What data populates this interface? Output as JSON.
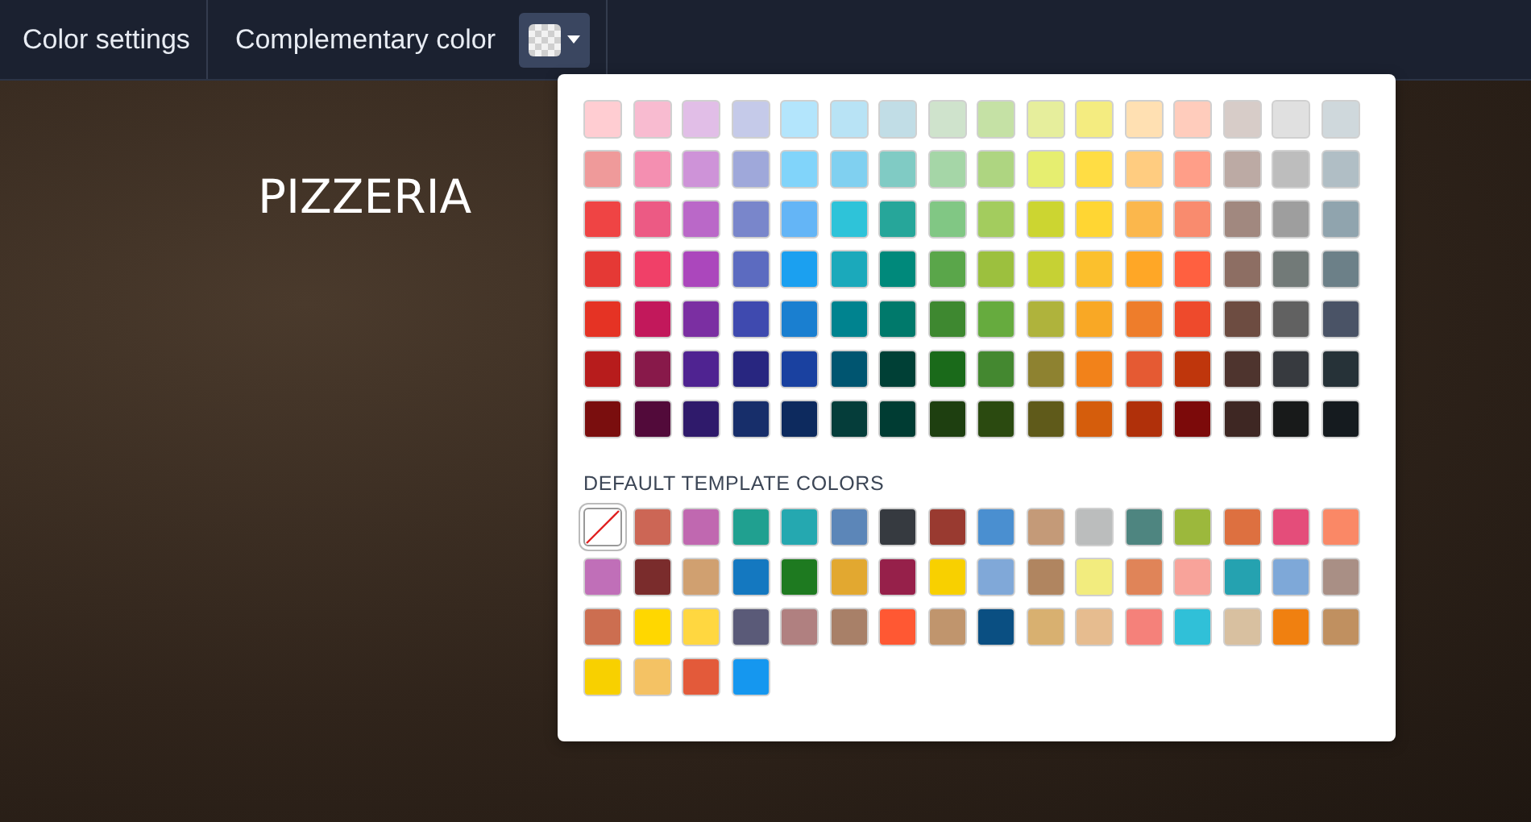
{
  "toolbar": {
    "items": [
      {
        "label": "Color settings"
      },
      {
        "label": "Complementary color"
      }
    ]
  },
  "background": {
    "heading": "PIZZERIA"
  },
  "palette": {
    "rows": [
      {
        "swatches": [
          {
            "color": "#ffcdd2"
          },
          {
            "color": "#f8bbd0"
          },
          {
            "color": "#e1bee7"
          },
          {
            "color": "#c5cae9"
          },
          {
            "color": "#b3e5fc"
          },
          {
            "color": "#b8e3f5"
          },
          {
            "color": "#c1dde6"
          },
          {
            "color": "#cfe3cc"
          },
          {
            "color": "#c5e1a5"
          },
          {
            "color": "#e6ee9c"
          },
          {
            "color": "#f4ec80"
          },
          {
            "color": "#ffe0b2"
          },
          {
            "color": "#ffccbc"
          },
          {
            "color": "#d7ccc8"
          },
          {
            "color": "#e0e0e0"
          },
          {
            "color": "#cfd8dc"
          }
        ]
      },
      {
        "swatches": [
          {
            "color": "#ef9a9a"
          },
          {
            "color": "#f48fb1"
          },
          {
            "color": "#ce93d8"
          },
          {
            "color": "#9fa8da"
          },
          {
            "color": "#81d4fa"
          },
          {
            "color": "#80d0f0"
          },
          {
            "color": "#80cbc4"
          },
          {
            "color": "#a5d6a7"
          },
          {
            "color": "#aed581"
          },
          {
            "color": "#e6ee70"
          },
          {
            "color": "#ffdd44"
          },
          {
            "color": "#ffcc80"
          },
          {
            "color": "#ff9e88"
          },
          {
            "color": "#bcaaa4"
          },
          {
            "color": "#bdbdbd"
          },
          {
            "color": "#b0bec5"
          }
        ]
      },
      {
        "swatches": [
          {
            "color": "#ef4444"
          },
          {
            "color": "#ec5a84"
          },
          {
            "color": "#ba68c8"
          },
          {
            "color": "#7986cb"
          },
          {
            "color": "#64b5f6"
          },
          {
            "color": "#2ec3d9"
          },
          {
            "color": "#26a69a"
          },
          {
            "color": "#81c784"
          },
          {
            "color": "#a3cc5e"
          },
          {
            "color": "#ccd531"
          },
          {
            "color": "#ffd633"
          },
          {
            "color": "#fbb74c"
          },
          {
            "color": "#f98b6e"
          },
          {
            "color": "#a1887f"
          },
          {
            "color": "#9e9e9e"
          },
          {
            "color": "#90a4ae"
          }
        ]
      },
      {
        "swatches": [
          {
            "color": "#e53935"
          },
          {
            "color": "#f04068"
          },
          {
            "color": "#ab47bc"
          },
          {
            "color": "#5c6bc0"
          },
          {
            "color": "#1ba0f0"
          },
          {
            "color": "#1ba9bb"
          },
          {
            "color": "#00897b"
          },
          {
            "color": "#5aa64a"
          },
          {
            "color": "#9cc03e"
          },
          {
            "color": "#c6d134"
          },
          {
            "color": "#fbc02d"
          },
          {
            "color": "#ffa726"
          },
          {
            "color": "#ff6040"
          },
          {
            "color": "#8d6e63"
          },
          {
            "color": "#727a78"
          },
          {
            "color": "#6c8088"
          }
        ]
      },
      {
        "swatches": [
          {
            "color": "#e53324"
          },
          {
            "color": "#c2185b"
          },
          {
            "color": "#7b2fa2"
          },
          {
            "color": "#3f4aaf"
          },
          {
            "color": "#1a7fd0"
          },
          {
            "color": "#00838f"
          },
          {
            "color": "#00796b"
          },
          {
            "color": "#3e8830"
          },
          {
            "color": "#66ab3e"
          },
          {
            "color": "#afb33c"
          },
          {
            "color": "#f9a825"
          },
          {
            "color": "#ee7d2b"
          },
          {
            "color": "#ee4a2c"
          },
          {
            "color": "#6d4c41"
          },
          {
            "color": "#616161"
          },
          {
            "color": "#4a5366"
          }
        ]
      },
      {
        "swatches": [
          {
            "color": "#b71c1c"
          },
          {
            "color": "#88194a"
          },
          {
            "color": "#4f2391"
          },
          {
            "color": "#282680"
          },
          {
            "color": "#1a41a0"
          },
          {
            "color": "#005570"
          },
          {
            "color": "#004036"
          },
          {
            "color": "#1a6a1a"
          },
          {
            "color": "#448830"
          },
          {
            "color": "#8e8230"
          },
          {
            "color": "#f2821a"
          },
          {
            "color": "#e55a33"
          },
          {
            "color": "#bf360c"
          },
          {
            "color": "#4e342e"
          },
          {
            "color": "#373a3f"
          },
          {
            "color": "#263238"
          }
        ]
      },
      {
        "swatches": [
          {
            "color": "#7a0e0e"
          },
          {
            "color": "#520a3a"
          },
          {
            "color": "#2f1a6b"
          },
          {
            "color": "#172e6a"
          },
          {
            "color": "#0d2a5e"
          },
          {
            "color": "#053d3a"
          },
          {
            "color": "#003c33"
          },
          {
            "color": "#1e3f10"
          },
          {
            "color": "#2b4a10"
          },
          {
            "color": "#5f5a1a"
          },
          {
            "color": "#d55d0c"
          },
          {
            "color": "#b0300a"
          },
          {
            "color": "#7c0a0a"
          },
          {
            "color": "#3e2723"
          },
          {
            "color": "#181a1a"
          },
          {
            "color": "#151b1f"
          }
        ]
      }
    ]
  },
  "default_colors": {
    "title": "DEFAULT TEMPLATE COLORS",
    "swatches": [
      {
        "kind": "none",
        "selected": true
      },
      {
        "kind": "color",
        "color": "#cc6655",
        "selected": false
      },
      {
        "kind": "color",
        "color": "#c068b0",
        "selected": false
      },
      {
        "kind": "color",
        "color": "#20a090",
        "selected": false
      },
      {
        "kind": "color",
        "color": "#25a8b0",
        "selected": false
      },
      {
        "kind": "color",
        "color": "#5c86b8",
        "selected": false
      },
      {
        "kind": "color",
        "color": "#363a40",
        "selected": false
      },
      {
        "kind": "color",
        "color": "#993a30",
        "selected": false
      },
      {
        "kind": "color",
        "color": "#4a8fd0",
        "selected": false
      },
      {
        "kind": "color",
        "color": "#c49a78",
        "selected": false
      },
      {
        "kind": "color",
        "color": "#bbbdbd",
        "selected": false
      },
      {
        "kind": "color",
        "color": "#4e8580",
        "selected": false
      },
      {
        "kind": "color",
        "color": "#9cb83c",
        "selected": false
      },
      {
        "kind": "color",
        "color": "#dd7040",
        "selected": false
      },
      {
        "kind": "color",
        "color": "#e44d7a",
        "selected": false
      },
      {
        "kind": "color",
        "color": "#fa8866",
        "selected": false
      },
      {
        "kind": "color",
        "color": "#c06fb8",
        "selected": false
      },
      {
        "kind": "color",
        "color": "#7a2c2c",
        "selected": false
      },
      {
        "kind": "color",
        "color": "#d0a070",
        "selected": false
      },
      {
        "kind": "color",
        "color": "#1478c0",
        "selected": false
      },
      {
        "kind": "color",
        "color": "#1e7a20",
        "selected": false
      },
      {
        "kind": "color",
        "color": "#e2a830",
        "selected": false
      },
      {
        "kind": "color",
        "color": "#96204a",
        "selected": false
      },
      {
        "kind": "color",
        "color": "#f8d000",
        "selected": false
      },
      {
        "kind": "color",
        "color": "#80a8d8",
        "selected": false
      },
      {
        "kind": "color",
        "color": "#b08560",
        "selected": false
      },
      {
        "kind": "color",
        "color": "#f2ec7e",
        "selected": false
      },
      {
        "kind": "color",
        "color": "#e08458",
        "selected": false
      },
      {
        "kind": "color",
        "color": "#f8a39a",
        "selected": false
      },
      {
        "kind": "color",
        "color": "#25a2b0",
        "selected": false
      },
      {
        "kind": "color",
        "color": "#7ea8d8",
        "selected": false
      },
      {
        "kind": "color",
        "color": "#a98f85",
        "selected": false
      },
      {
        "kind": "color",
        "color": "#cc6e50",
        "selected": false
      },
      {
        "kind": "color",
        "color": "#ffd700",
        "selected": false
      },
      {
        "kind": "color",
        "color": "#ffd740",
        "selected": false
      },
      {
        "kind": "color",
        "color": "#5a5a78",
        "selected": false
      },
      {
        "kind": "color",
        "color": "#b08080",
        "selected": false
      },
      {
        "kind": "color",
        "color": "#a88068",
        "selected": false
      },
      {
        "kind": "color",
        "color": "#ff5833",
        "selected": false
      },
      {
        "kind": "color",
        "color": "#c0956d",
        "selected": false
      },
      {
        "kind": "color",
        "color": "#0a4f82",
        "selected": false
      },
      {
        "kind": "color",
        "color": "#d8b070",
        "selected": false
      },
      {
        "kind": "color",
        "color": "#e6bc8f",
        "selected": false
      },
      {
        "kind": "color",
        "color": "#f5817a",
        "selected": false
      },
      {
        "kind": "color",
        "color": "#30c0d8",
        "selected": false
      },
      {
        "kind": "color",
        "color": "#d8c0a0",
        "selected": false
      },
      {
        "kind": "color",
        "color": "#f08010",
        "selected": false
      },
      {
        "kind": "color",
        "color": "#c09060",
        "selected": false
      },
      {
        "kind": "color",
        "color": "#f8d000",
        "selected": false
      },
      {
        "kind": "color",
        "color": "#f4c264",
        "selected": false
      },
      {
        "kind": "color",
        "color": "#e35a3a",
        "selected": false
      },
      {
        "kind": "color",
        "color": "#1597ef",
        "selected": false
      }
    ]
  }
}
